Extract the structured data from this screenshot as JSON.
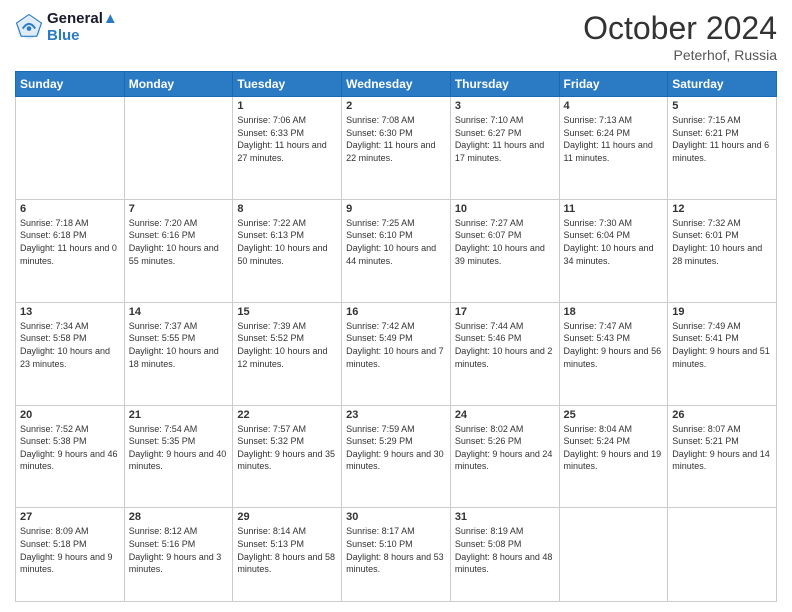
{
  "header": {
    "logo_line1": "General",
    "logo_line2": "Blue",
    "month": "October 2024",
    "location": "Peterhof, Russia"
  },
  "weekdays": [
    "Sunday",
    "Monday",
    "Tuesday",
    "Wednesday",
    "Thursday",
    "Friday",
    "Saturday"
  ],
  "weeks": [
    [
      {
        "day": "",
        "info": ""
      },
      {
        "day": "",
        "info": ""
      },
      {
        "day": "1",
        "info": "Sunrise: 7:06 AM\nSunset: 6:33 PM\nDaylight: 11 hours and 27 minutes."
      },
      {
        "day": "2",
        "info": "Sunrise: 7:08 AM\nSunset: 6:30 PM\nDaylight: 11 hours and 22 minutes."
      },
      {
        "day": "3",
        "info": "Sunrise: 7:10 AM\nSunset: 6:27 PM\nDaylight: 11 hours and 17 minutes."
      },
      {
        "day": "4",
        "info": "Sunrise: 7:13 AM\nSunset: 6:24 PM\nDaylight: 11 hours and 11 minutes."
      },
      {
        "day": "5",
        "info": "Sunrise: 7:15 AM\nSunset: 6:21 PM\nDaylight: 11 hours and 6 minutes."
      }
    ],
    [
      {
        "day": "6",
        "info": "Sunrise: 7:18 AM\nSunset: 6:18 PM\nDaylight: 11 hours and 0 minutes."
      },
      {
        "day": "7",
        "info": "Sunrise: 7:20 AM\nSunset: 6:16 PM\nDaylight: 10 hours and 55 minutes."
      },
      {
        "day": "8",
        "info": "Sunrise: 7:22 AM\nSunset: 6:13 PM\nDaylight: 10 hours and 50 minutes."
      },
      {
        "day": "9",
        "info": "Sunrise: 7:25 AM\nSunset: 6:10 PM\nDaylight: 10 hours and 44 minutes."
      },
      {
        "day": "10",
        "info": "Sunrise: 7:27 AM\nSunset: 6:07 PM\nDaylight: 10 hours and 39 minutes."
      },
      {
        "day": "11",
        "info": "Sunrise: 7:30 AM\nSunset: 6:04 PM\nDaylight: 10 hours and 34 minutes."
      },
      {
        "day": "12",
        "info": "Sunrise: 7:32 AM\nSunset: 6:01 PM\nDaylight: 10 hours and 28 minutes."
      }
    ],
    [
      {
        "day": "13",
        "info": "Sunrise: 7:34 AM\nSunset: 5:58 PM\nDaylight: 10 hours and 23 minutes."
      },
      {
        "day": "14",
        "info": "Sunrise: 7:37 AM\nSunset: 5:55 PM\nDaylight: 10 hours and 18 minutes."
      },
      {
        "day": "15",
        "info": "Sunrise: 7:39 AM\nSunset: 5:52 PM\nDaylight: 10 hours and 12 minutes."
      },
      {
        "day": "16",
        "info": "Sunrise: 7:42 AM\nSunset: 5:49 PM\nDaylight: 10 hours and 7 minutes."
      },
      {
        "day": "17",
        "info": "Sunrise: 7:44 AM\nSunset: 5:46 PM\nDaylight: 10 hours and 2 minutes."
      },
      {
        "day": "18",
        "info": "Sunrise: 7:47 AM\nSunset: 5:43 PM\nDaylight: 9 hours and 56 minutes."
      },
      {
        "day": "19",
        "info": "Sunrise: 7:49 AM\nSunset: 5:41 PM\nDaylight: 9 hours and 51 minutes."
      }
    ],
    [
      {
        "day": "20",
        "info": "Sunrise: 7:52 AM\nSunset: 5:38 PM\nDaylight: 9 hours and 46 minutes."
      },
      {
        "day": "21",
        "info": "Sunrise: 7:54 AM\nSunset: 5:35 PM\nDaylight: 9 hours and 40 minutes."
      },
      {
        "day": "22",
        "info": "Sunrise: 7:57 AM\nSunset: 5:32 PM\nDaylight: 9 hours and 35 minutes."
      },
      {
        "day": "23",
        "info": "Sunrise: 7:59 AM\nSunset: 5:29 PM\nDaylight: 9 hours and 30 minutes."
      },
      {
        "day": "24",
        "info": "Sunrise: 8:02 AM\nSunset: 5:26 PM\nDaylight: 9 hours and 24 minutes."
      },
      {
        "day": "25",
        "info": "Sunrise: 8:04 AM\nSunset: 5:24 PM\nDaylight: 9 hours and 19 minutes."
      },
      {
        "day": "26",
        "info": "Sunrise: 8:07 AM\nSunset: 5:21 PM\nDaylight: 9 hours and 14 minutes."
      }
    ],
    [
      {
        "day": "27",
        "info": "Sunrise: 8:09 AM\nSunset: 5:18 PM\nDaylight: 9 hours and 9 minutes."
      },
      {
        "day": "28",
        "info": "Sunrise: 8:12 AM\nSunset: 5:16 PM\nDaylight: 9 hours and 3 minutes."
      },
      {
        "day": "29",
        "info": "Sunrise: 8:14 AM\nSunset: 5:13 PM\nDaylight: 8 hours and 58 minutes."
      },
      {
        "day": "30",
        "info": "Sunrise: 8:17 AM\nSunset: 5:10 PM\nDaylight: 8 hours and 53 minutes."
      },
      {
        "day": "31",
        "info": "Sunrise: 8:19 AM\nSunset: 5:08 PM\nDaylight: 8 hours and 48 minutes."
      },
      {
        "day": "",
        "info": ""
      },
      {
        "day": "",
        "info": ""
      }
    ]
  ]
}
